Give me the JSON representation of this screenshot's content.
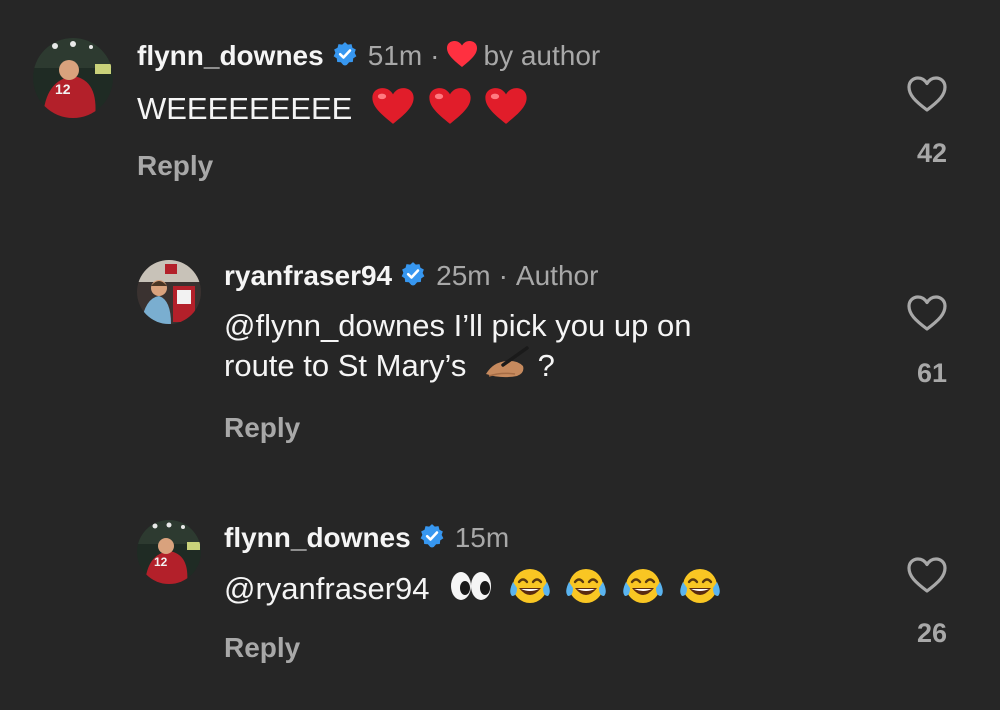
{
  "comments": [
    {
      "username": "flynn_downes",
      "time": "51m",
      "separator": "·",
      "liked_label": "by author",
      "text": "WEEEEEEEEE",
      "emojis": [
        "red-heart",
        "red-heart",
        "red-heart"
      ],
      "reply_label": "Reply",
      "likes": "42"
    },
    {
      "username": "ryanfraser94",
      "time": "25m",
      "separator": "·",
      "author_label": "Author",
      "mention": "@flynn_downes",
      "text_line1": " I’ll pick you up on",
      "text_line2": "route to St Mary’s",
      "text_end": " ?",
      "emojis": [
        "writing-hand"
      ],
      "reply_label": "Reply",
      "likes": "61"
    },
    {
      "username": "flynn_downes",
      "time": "15m",
      "mention": "@ryanfraser94",
      "emojis": [
        "eyes",
        "tears-of-joy",
        "tears-of-joy",
        "tears-of-joy",
        "tears-of-joy"
      ],
      "reply_label": "Reply",
      "likes": "26"
    }
  ],
  "colors": {
    "background": "#262626",
    "text": "#f5f5f5",
    "muted": "#a8a8a8",
    "verified": "#3797f0",
    "heart": "#ff3040"
  }
}
